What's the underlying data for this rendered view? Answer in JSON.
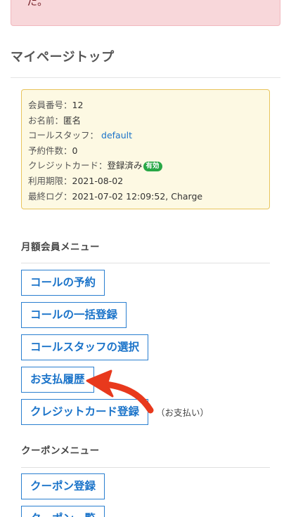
{
  "alert": {
    "text": "た。"
  },
  "page": {
    "title": "マイページトップ"
  },
  "member_info": {
    "member_no": {
      "label": "会員番号：",
      "value": "12"
    },
    "name": {
      "label": "お名前：",
      "value": "匿名"
    },
    "call_staff": {
      "label": "コールスタッフ：",
      "value": "default"
    },
    "reservations": {
      "label": "予約件数：",
      "value": "0"
    },
    "credit_card": {
      "label": "クレジットカード：",
      "value": "登録済み",
      "badge": "有効"
    },
    "expiry": {
      "label": "利用期限：",
      "value": "2021-08-02"
    },
    "last_log": {
      "label": "最終ログ：",
      "value": "2021-07-02 12:09:52, Charge"
    }
  },
  "monthly_menu": {
    "heading": "月額会員メニュー",
    "items": [
      {
        "label": "コールの予約"
      },
      {
        "label": "コールの一括登録"
      },
      {
        "label": "コールスタッフの選択"
      },
      {
        "label": "お支払履歴"
      },
      {
        "label": "クレジットカード登録"
      }
    ],
    "credit_note": "（お支払い）"
  },
  "coupon_menu": {
    "heading": "クーポンメニュー",
    "items": [
      {
        "label": "クーポン登録"
      },
      {
        "label": "クーポン一覧"
      }
    ]
  },
  "colors": {
    "accent": "#1a73c9",
    "annotation_arrow": "#e8391d",
    "badge": "#28a745"
  },
  "icons": {
    "annotation": "red-arrow-icon"
  }
}
